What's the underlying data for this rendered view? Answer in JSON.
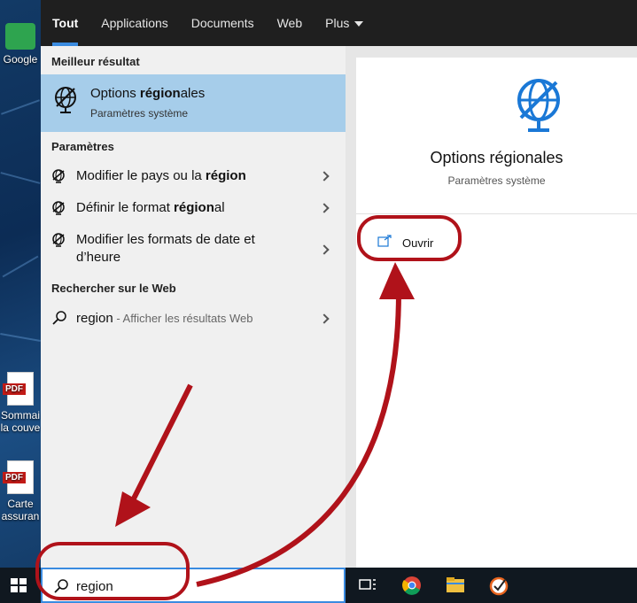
{
  "desktop": {
    "icons": [
      {
        "label": "Google"
      },
      {
        "label_line1": "Sommai",
        "label_line2": "la couve",
        "badge": "PDF"
      },
      {
        "label_line1": "Carte",
        "label_line2": "assuran",
        "badge": "PDF"
      }
    ]
  },
  "tabs": [
    {
      "label": "Tout"
    },
    {
      "label": "Applications"
    },
    {
      "label": "Documents"
    },
    {
      "label": "Web"
    },
    {
      "label": "Plus"
    }
  ],
  "best_match": {
    "heading": "Meilleur résultat",
    "title_pre": "Options ",
    "title_bold": "région",
    "title_post": "ales",
    "subtitle": "Paramètres système"
  },
  "settings": {
    "heading": "Paramètres",
    "items": [
      {
        "pre": "Modifier le pays ou la ",
        "bold": "région",
        "post": ""
      },
      {
        "pre": "Définir le format ",
        "bold": "région",
        "post": "al"
      },
      {
        "pre": "Modifier les formats de date et d’heure",
        "bold": "",
        "post": ""
      }
    ]
  },
  "web": {
    "heading": "Rechercher sur le Web",
    "query": "region",
    "suffix": " - Afficher les résultats Web"
  },
  "preview": {
    "title": "Options régionales",
    "subtitle": "Paramètres système",
    "open_label": "Ouvrir"
  },
  "search": {
    "value": "region"
  },
  "colors": {
    "accent": "#3a8be0",
    "highlight": "#a6cdea",
    "annotation": "#b0121a"
  }
}
